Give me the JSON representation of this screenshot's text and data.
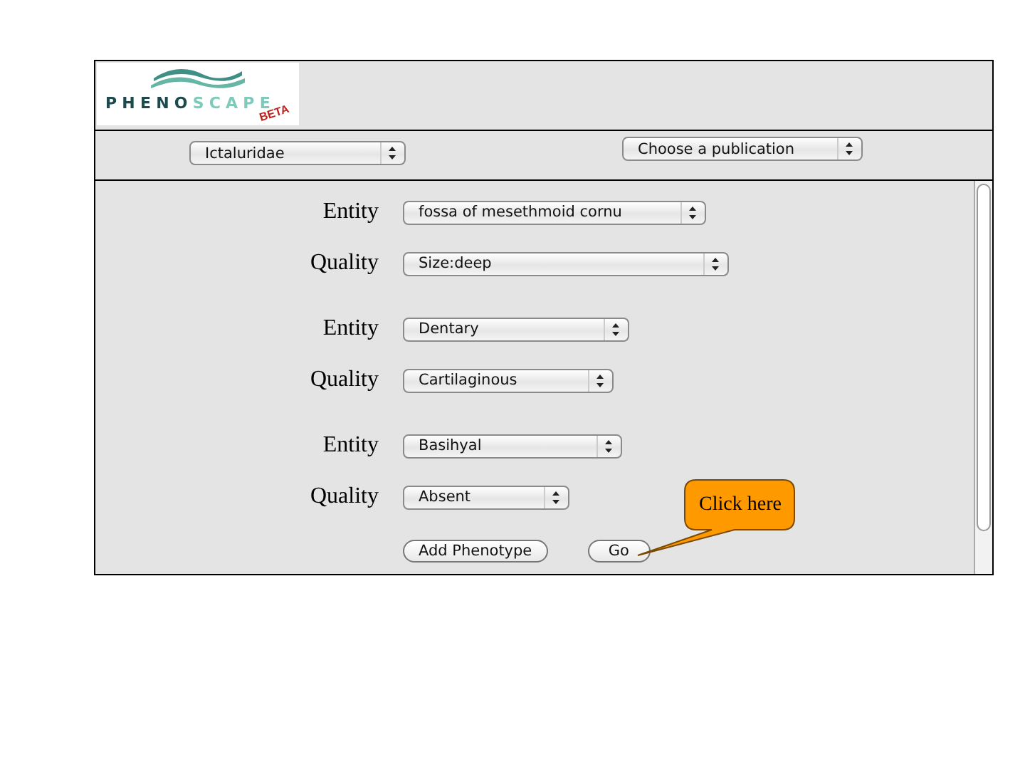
{
  "logo": {
    "wordmark": [
      {
        "text": "PHENO",
        "color": "#1d4a4c"
      },
      {
        "text": "SCAPE",
        "color": "#7fcbbb"
      }
    ],
    "badge": "BETA"
  },
  "filters": [
    {
      "value": "Ictaluridae"
    },
    {
      "value": "Choose a publication"
    }
  ],
  "phenotypes": [
    {
      "entity_label": "Entity",
      "entity": "fossa of mesethmoid cornu",
      "quality_label": "Quality",
      "quality": "Size:deep"
    },
    {
      "entity_label": "Entity",
      "entity": "Dentary",
      "quality_label": "Quality",
      "quality": "Cartilaginous"
    },
    {
      "entity_label": "Entity",
      "entity": "Basihyal",
      "quality_label": "Quality",
      "quality": "Absent"
    }
  ],
  "buttons": [
    "Add Phenotype",
    "Go"
  ],
  "callout": "Click here"
}
